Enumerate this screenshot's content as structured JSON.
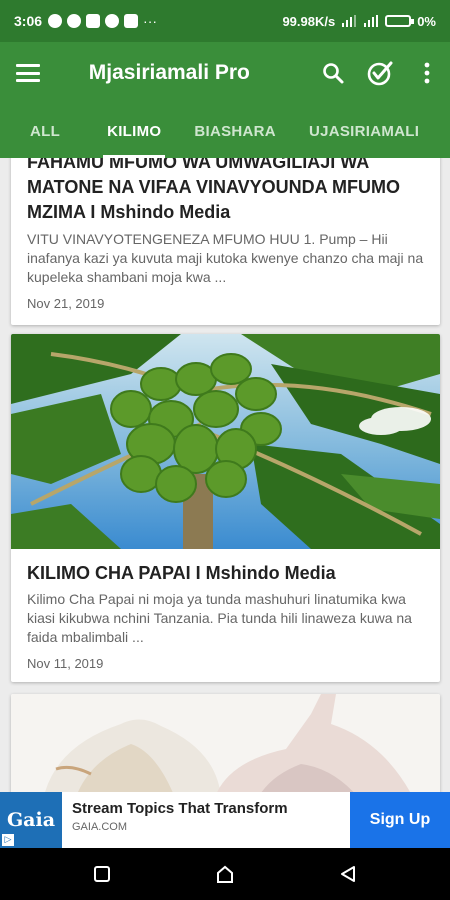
{
  "status_bar": {
    "time": "3:06",
    "net_speed": "99.98K/s",
    "battery": "0%"
  },
  "app_bar": {
    "title": "Mjasiriamali Pro",
    "icons": [
      "menu-icon",
      "search-icon",
      "check-circle-icon",
      "more-vert-icon"
    ]
  },
  "tabs": [
    {
      "label": "ALL",
      "active": false
    },
    {
      "label": "KILIMO",
      "active": true
    },
    {
      "label": "BIASHARA",
      "active": false
    },
    {
      "label": "UJASIRIAMALI",
      "active": false
    }
  ],
  "posts": [
    {
      "title": "FAHAMU MFUMO WA UMWAGILIAJI WA MATONE NA VIFAA VINAVYOUNDA MFUMO MZIMA I Mshindo Media",
      "excerpt": "VITU VINAVYOTENGENEZA MFUMO HUU 1. Pump – Hii inafanya kazi ya kuvuta maji kutoka kwenye chanzo cha maji na kupeleka shambani moja kwa ...",
      "date": "Nov 21, 2019"
    },
    {
      "title": "KILIMO CHA PAPAI I Mshindo Media",
      "excerpt": "Kilimo Cha Papai ni moja ya tunda mashuhuri linatumika kwa kiasi kikubwa nchini Tanzania. Pia tunda hili linaweza kuwa na faida mbalimbali ...",
      "date": "Nov 11, 2019"
    }
  ],
  "ad": {
    "logo_text": "Gaia",
    "headline": "Stream Topics That Transform",
    "domain": "GAIA.COM",
    "cta": "Sign Up",
    "colors": {
      "logo_bg": "#1e6fb6",
      "cta_bg": "#1a73e8"
    }
  },
  "colors": {
    "status_bar": "#2e7a2e",
    "app_bar": "#3a8e3a"
  }
}
